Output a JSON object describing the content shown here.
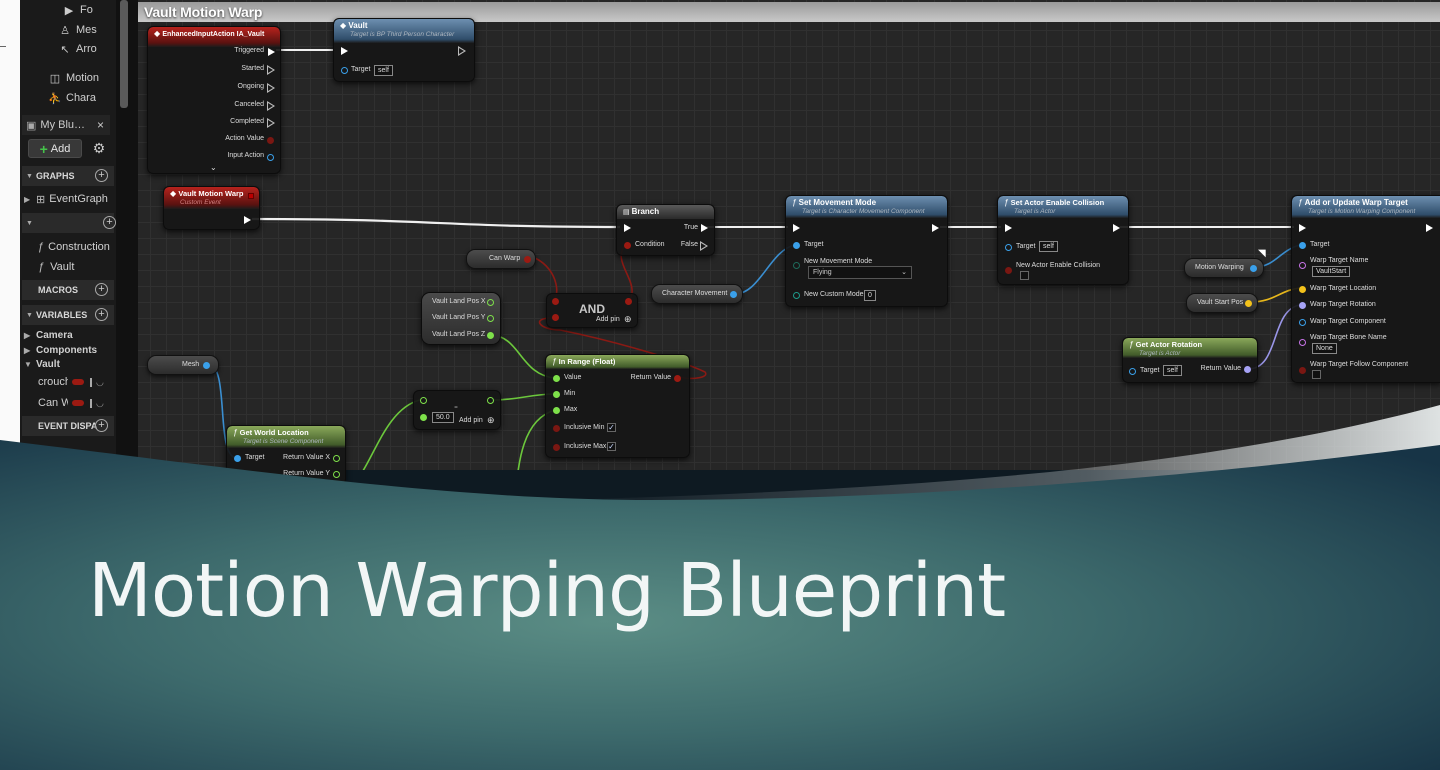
{
  "panel": {
    "components": [
      {
        "icon": "camera-icon",
        "glyph": "▶",
        "label": "Fo"
      },
      {
        "icon": "mesh-icon",
        "glyph": "♙",
        "label": "Mes"
      },
      {
        "icon": "arrow-icon",
        "glyph": "↖",
        "label": "Arro"
      },
      {
        "icon": "motion-icon",
        "glyph": "◫",
        "label": "Motion"
      },
      {
        "icon": "character-icon",
        "glyph": "⛹",
        "label": "Chara"
      }
    ],
    "tab_label": "My Blu…",
    "tab_close": "×",
    "add_label": "Add",
    "sections": {
      "graphs": "GRAPHS",
      "macros": "MACROS",
      "variables": "VARIABLES",
      "event_dispatchers": "EVENT DISPA"
    },
    "event_graph": "EventGraph",
    "functions": [
      "Construction",
      "Vault"
    ],
    "var_categories": [
      "Camera",
      "Components",
      "Vault"
    ],
    "vars": [
      {
        "name": "crouch",
        "color": "#9c1a12"
      },
      {
        "name": "Can W",
        "color": "#9c1a12"
      }
    ]
  },
  "graph": {
    "title": "Vault Motion Warp",
    "nodes": {
      "input_action": {
        "title": "EnhancedInputAction IA_Vault",
        "pins": [
          "Triggered",
          "Started",
          "Ongoing",
          "Canceled",
          "Completed",
          "Action Value",
          "Input Action"
        ]
      },
      "vault_call": {
        "title": "Vault",
        "subtitle": "Target is BP Third Person Character",
        "target_label": "Target",
        "target_value": "self"
      },
      "custom_event": {
        "title": "Vault Motion Warp",
        "subtitle": "Custom Event"
      },
      "branch": {
        "title": "Branch",
        "condition": "Condition",
        "true_label": "True",
        "false_label": "False"
      },
      "can_warp": {
        "label": "Can Warp"
      },
      "and_node": {
        "title": "AND",
        "add_pin": "Add pin"
      },
      "land_pos": [
        "Vault Land Pos X",
        "Vault Land Pos Y",
        "Vault Land Pos Z"
      ],
      "character_movement": {
        "label": "Character Movement"
      },
      "set_movement_mode": {
        "title": "Set Movement Mode",
        "subtitle": "Target is Character Movement Component",
        "target_label": "Target",
        "mode_label": "New Movement Mode",
        "mode_value": "Flying",
        "custom_label": "New Custom Mode",
        "custom_value": "0"
      },
      "set_collision": {
        "title": "Set Actor Enable Collision",
        "subtitle": "Target is Actor",
        "target_label": "Target",
        "target_value": "self",
        "collision_label": "New Actor Enable Collision"
      },
      "warp_target": {
        "title": "Add or Update Warp Target",
        "subtitle": "Target is Motion Warping Component",
        "pins": [
          "Target",
          "Warp Target Name",
          "Warp Target Location",
          "Warp Target Rotation",
          "Warp Target Component",
          "Warp Target Bone Name",
          "Warp Target Follow Component"
        ],
        "name_value": "VaultStart",
        "bone_value": "None"
      },
      "motion_warping": {
        "label": "Motion Warping"
      },
      "vault_start_pos": {
        "label": "Vault Start Pos"
      },
      "get_rotation": {
        "title": "Get Actor Rotation",
        "subtitle": "Target is Actor",
        "target_label": "Target",
        "target_value": "self",
        "return_label": "Return Value"
      },
      "mesh": {
        "label": "Mesh"
      },
      "get_world_location": {
        "title": "Get World Location",
        "subtitle": "Target is Scene Component",
        "target_label": "Target",
        "rx": "Return Value X",
        "ry": "Return Value Y"
      },
      "subtract": {
        "title": "-",
        "value": "50.0",
        "add_pin": "Add pin"
      },
      "in_range": {
        "title": "In Range (Float)",
        "pins": [
          "Value",
          "Min",
          "Max",
          "Inclusive Min",
          "Inclusive Max"
        ],
        "return_label": "Return Value"
      }
    }
  },
  "slide": {
    "title": "Motion Warping Blueprint"
  },
  "colors": {
    "exec": "#ffffff",
    "bool": "#9c1a12",
    "float": "#7ee04a",
    "object": "#3aa0ea",
    "vector": "#f3c21b",
    "rotator": "#a6a2f5",
    "name": "#c874e8",
    "banner_dark": "#163443",
    "banner_light": "#4f7e79"
  }
}
